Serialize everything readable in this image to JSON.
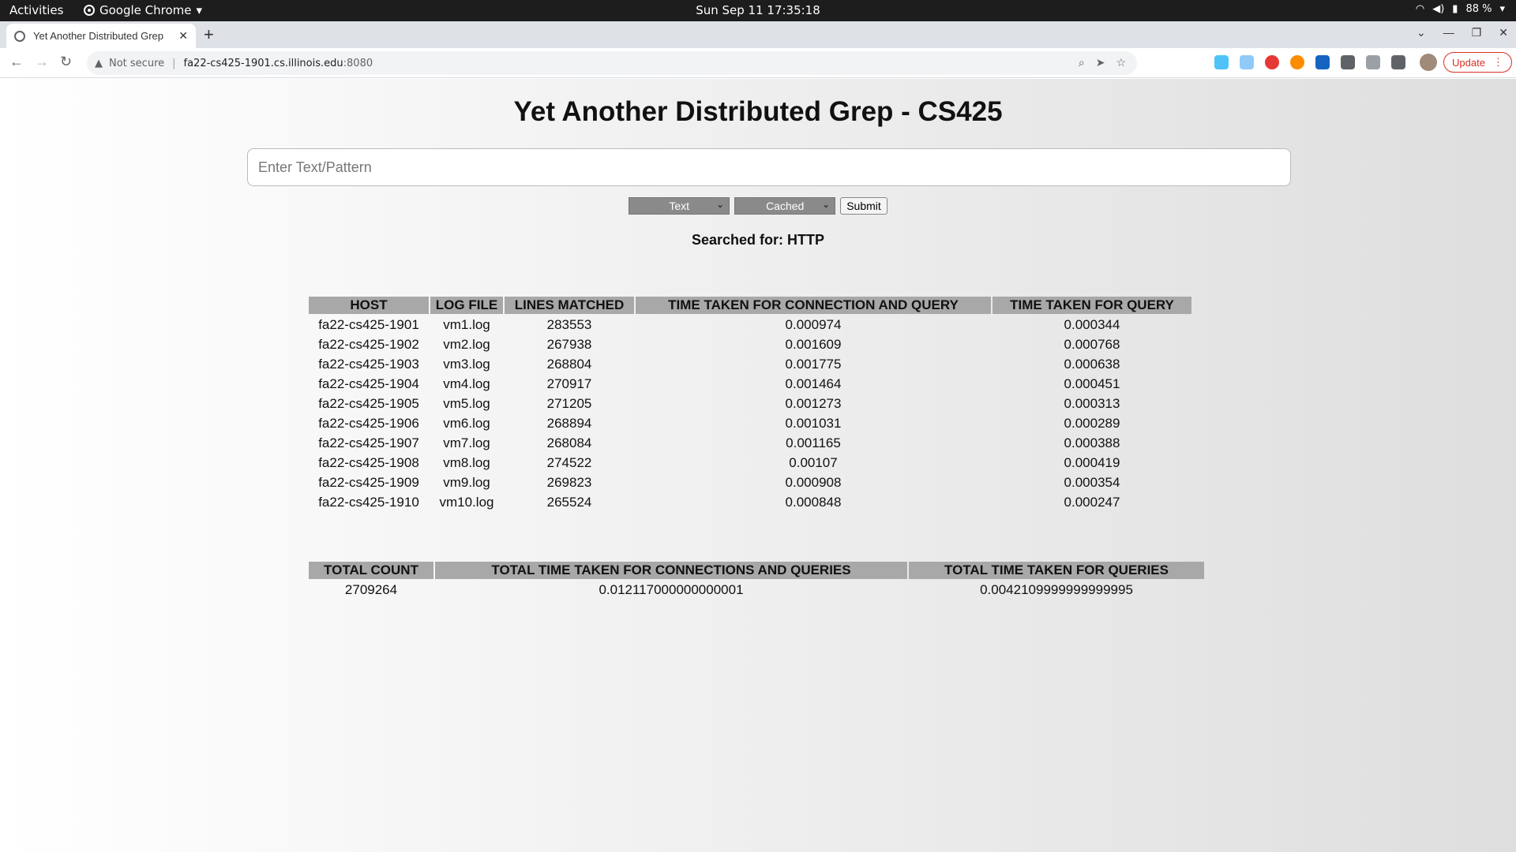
{
  "topbar": {
    "activities": "Activities",
    "app_menu": "Google Chrome",
    "clock": "Sun Sep 11  17:35:18",
    "battery": "88 %"
  },
  "browser": {
    "tab_title": "Yet Another Distributed Grep",
    "security_label": "Not secure",
    "url_host": "fa22-cs425-1901.cs.illinois.edu",
    "url_port": ":8080",
    "update_label": "Update"
  },
  "page": {
    "title": "Yet Another Distributed Grep - CS425",
    "input_placeholder": "Enter Text/Pattern",
    "mode_select": "Text",
    "cache_select": "Cached",
    "submit_label": "Submit",
    "searched_for": "Searched for: HTTP"
  },
  "results": {
    "headers": [
      "HOST",
      "LOG FILE",
      "LINES MATCHED",
      "TIME TAKEN FOR CONNECTION AND QUERY",
      "TIME TAKEN FOR QUERY"
    ],
    "rows": [
      [
        "fa22-cs425-1901",
        "vm1.log",
        "283553",
        "0.000974",
        "0.000344"
      ],
      [
        "fa22-cs425-1902",
        "vm2.log",
        "267938",
        "0.001609",
        "0.000768"
      ],
      [
        "fa22-cs425-1903",
        "vm3.log",
        "268804",
        "0.001775",
        "0.000638"
      ],
      [
        "fa22-cs425-1904",
        "vm4.log",
        "270917",
        "0.001464",
        "0.000451"
      ],
      [
        "fa22-cs425-1905",
        "vm5.log",
        "271205",
        "0.001273",
        "0.000313"
      ],
      [
        "fa22-cs425-1906",
        "vm6.log",
        "268894",
        "0.001031",
        "0.000289"
      ],
      [
        "fa22-cs425-1907",
        "vm7.log",
        "268084",
        "0.001165",
        "0.000388"
      ],
      [
        "fa22-cs425-1908",
        "vm8.log",
        "274522",
        "0.00107",
        "0.000419"
      ],
      [
        "fa22-cs425-1909",
        "vm9.log",
        "269823",
        "0.000908",
        "0.000354"
      ],
      [
        "fa22-cs425-1910",
        "vm10.log",
        "265524",
        "0.000848",
        "0.000247"
      ]
    ]
  },
  "totals": {
    "headers": [
      "TOTAL COUNT",
      "TOTAL TIME TAKEN FOR CONNECTIONS AND QUERIES",
      "TOTAL TIME TAKEN FOR QUERIES"
    ],
    "values": [
      "2709264",
      "0.012117000000000001",
      "0.0042109999999999995"
    ]
  },
  "colors": {
    "header_bg": "#a8a8a8",
    "select_bg": "#8a8a8a",
    "update_red": "#d93025"
  }
}
